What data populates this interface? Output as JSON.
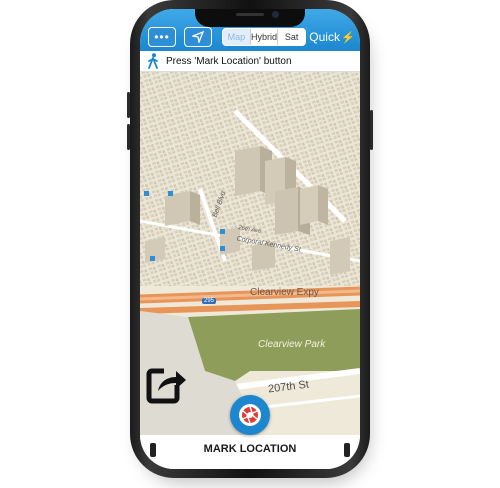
{
  "toolbar": {
    "menu_icon": "more-dots-icon",
    "locate_icon": "navigation-arrow-icon",
    "map_types": [
      "Map",
      "Hybrid",
      "Sat"
    ],
    "selected_map_type": "Map",
    "quick_label": "Quick",
    "quick_icon": "lightning-bolt-icon"
  },
  "instruction": {
    "icon": "walking-person-icon",
    "text": "Press 'Mark Location' button"
  },
  "map": {
    "labels": {
      "expressway": "Clearview Expy",
      "highway_shield": "295",
      "park": "Clearview Park",
      "street_207": "207th St",
      "corporal": "Corporal Kennedy St",
      "bell": "Bell Blvd",
      "side_label": "26th Ave"
    }
  },
  "actions": {
    "share_icon": "share-arrow-icon",
    "mark_icon": "camera-shutter-icon",
    "mark_label": "MARK LOCATION"
  },
  "colors": {
    "accent": "#1c86cf",
    "map_bg": "#f2efe6",
    "park": "#8e9d5a",
    "highway": "#e8955a"
  }
}
